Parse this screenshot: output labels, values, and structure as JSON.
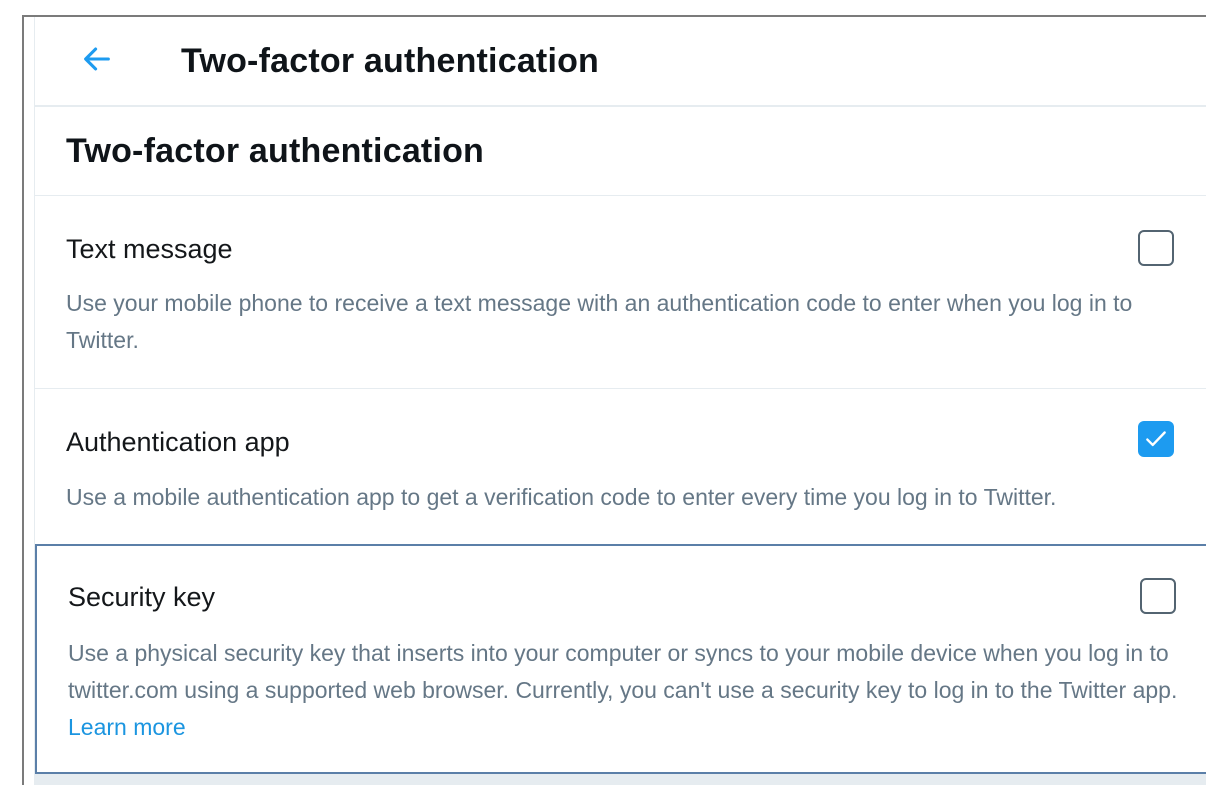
{
  "header": {
    "back_icon": "arrow-left-icon",
    "title": "Two-factor authentication"
  },
  "section": {
    "title": "Two-factor authentication"
  },
  "options": [
    {
      "label": "Text message",
      "description": "Use your mobile phone to receive a text message with an authentication code to enter when you log in to Twitter.",
      "checked": false
    },
    {
      "label": "Authentication app",
      "description": "Use a mobile authentication app to get a verification code to enter every time you log in to Twitter.",
      "checked": true
    },
    {
      "label": "Security key",
      "description": "Use a physical security key that inserts into your computer or syncs to your mobile device when you log in to twitter.com using a supported web browser. Currently, you can't use a security key to log in to the Twitter app.",
      "link": "Learn more",
      "checked": false
    }
  ],
  "colors": {
    "accent": "#1d9bf0",
    "link": "#1b95e0",
    "secondary_text": "#657786",
    "divider": "#e6ecf0"
  }
}
